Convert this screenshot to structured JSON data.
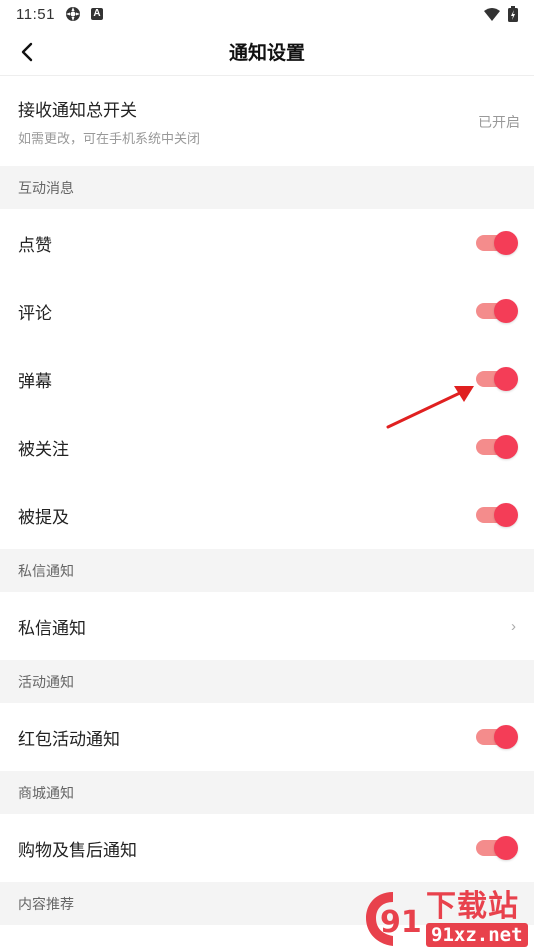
{
  "status_bar": {
    "time": "11:51",
    "left_icons": [
      "settings-icon",
      "a-notification-icon"
    ],
    "right_icons": [
      "wifi-icon",
      "battery-icon"
    ]
  },
  "nav": {
    "title": "通知设置",
    "back_icon": "chevron-left-icon"
  },
  "master": {
    "label": "接收通知总开关",
    "sub": "如需更改，可在手机系统中关闭",
    "status": "已开启"
  },
  "sections": {
    "interaction": {
      "header": "互动消息",
      "items": [
        {
          "label": "点赞",
          "on": true
        },
        {
          "label": "评论",
          "on": true
        },
        {
          "label": "弹幕",
          "on": true
        },
        {
          "label": "被关注",
          "on": true
        },
        {
          "label": "被提及",
          "on": true
        }
      ]
    },
    "private": {
      "header": "私信通知",
      "item": {
        "label": "私信通知",
        "chevron": "›"
      }
    },
    "activity": {
      "header": "活动通知",
      "item": {
        "label": "红包活动通知",
        "on": true
      }
    },
    "mall": {
      "header": "商城通知",
      "item": {
        "label": "购物及售后通知",
        "on": true
      }
    },
    "content": {
      "header": "内容推荐"
    }
  },
  "colors": {
    "toggle_knob": "#f43d57",
    "toggle_track": "#f48c8c",
    "annotation_arrow": "#e02020",
    "watermark": "#e8414c"
  },
  "watermark": {
    "big_text": "下载站",
    "url": "91xz.net",
    "logo_text": "91"
  }
}
